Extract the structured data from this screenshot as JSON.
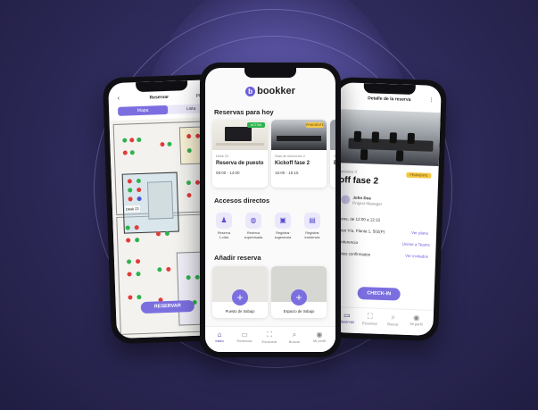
{
  "brand": {
    "name": "bookker",
    "accent": "#7b6fe0",
    "dark": "#3a2f9e",
    "background": "#2f2b5c"
  },
  "left_phone": {
    "title": "Reservar",
    "title_cut": "Pla",
    "tabs": [
      "Mapa",
      "Lista"
    ],
    "map_caption": "Desk 22",
    "reserve_button": "RESERVAR"
  },
  "center_phone": {
    "app_name": "bookker",
    "section_today": "Reservas para hoy",
    "cards": [
      {
        "small": "Desk 22",
        "name": "Reserva de puesto",
        "time": "08:00 - 14:00",
        "tag": "ACTIVA",
        "tag_color": "#2fb24e"
      },
      {
        "small": "Sala de reuniones 4",
        "name": "Kickoff fase 2",
        "time": "15:00 - 15:15",
        "tag": "PENDIENTE",
        "tag_color": "#f7c948"
      },
      {
        "small": "Sa",
        "name": "Es",
        "time": "",
        "tag": "",
        "tag_color": ""
      }
    ],
    "section_shortcuts": "Accesos directos",
    "shortcuts": [
      {
        "label1": "Reserva",
        "label2": "1-click",
        "icon": "user-icon"
      },
      {
        "label1": "Reserva",
        "label2": "supervisada",
        "icon": "shield-icon"
      },
      {
        "label1": "Registrar",
        "label2": "sugerencia",
        "icon": "chat-icon"
      },
      {
        "label1": "Registrar",
        "label2": "incidencia",
        "icon": "alert-icon"
      }
    ],
    "section_add": "Añadir reserva",
    "add_cards": [
      {
        "label": "Puesto de trabajo"
      },
      {
        "label": "Espacio de trabajo"
      }
    ],
    "tabbar": [
      {
        "label": "Inicio",
        "icon": "home-icon",
        "active": true
      },
      {
        "label": "Reservas",
        "icon": "calendar-icon",
        "active": false
      },
      {
        "label": "Escanear",
        "icon": "scan-icon",
        "active": false
      },
      {
        "label": "Buscar",
        "icon": "search-icon",
        "active": false
      },
      {
        "label": "Mi perfil",
        "icon": "profile-icon",
        "active": false
      }
    ]
  },
  "right_phone": {
    "title": "Detalle de la reserva",
    "room_small": "uniones 4",
    "status_badge": "PENDIENTE",
    "meeting_title": "off fase 2",
    "organizer_name": "John Doe",
    "organizer_role": "Project Manager",
    "datetime": "5 ene, de 12:00 a 12:15",
    "address": "Gran Vía, Planta 1, 502(P)",
    "address_link": "Ver plano",
    "video_label": "conferencia",
    "video_link": "Unirse a Teams",
    "attendees_label": "tentes confirmados",
    "attendees_link": "Ver invitados",
    "checkin_button": "CHECK-IN",
    "tabbar": [
      {
        "label": "Reservas",
        "icon": "calendar-icon",
        "active": true
      },
      {
        "label": "Escanear",
        "icon": "scan-icon",
        "active": false
      },
      {
        "label": "Buscar",
        "icon": "search-icon",
        "active": false
      },
      {
        "label": "Mi perfil",
        "icon": "profile-icon",
        "active": false
      }
    ]
  }
}
